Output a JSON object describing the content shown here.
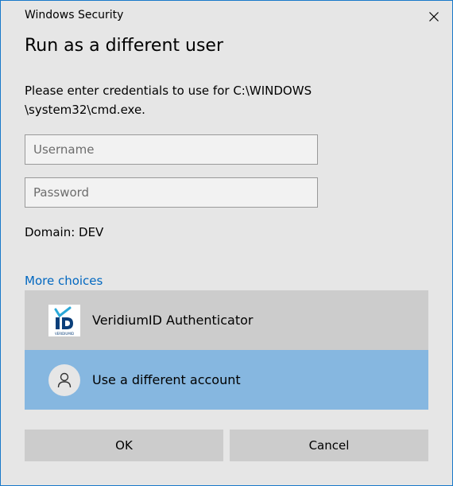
{
  "window": {
    "title": "Windows Security",
    "close_icon": "close-icon",
    "accent_border": "#1979ca"
  },
  "dialog": {
    "heading": "Run as a different user",
    "message_line1": "Please enter credentials to use for C:\\WINDOWS",
    "message_line2": "\\system32\\cmd.exe."
  },
  "form": {
    "username": {
      "value": "",
      "placeholder": "Username"
    },
    "password": {
      "value": "",
      "placeholder": "Password"
    },
    "domain": "Domain: DEV"
  },
  "more_choices": {
    "link": "More choices",
    "link_color": "#0067c0",
    "items": [
      {
        "label": "VeridiumID Authenticator",
        "icon": "veridiumid-logo-icon",
        "logo_text": "VERIDIUMID",
        "selected": false
      },
      {
        "label": "Use a different account",
        "icon": "user-icon",
        "selected": true
      }
    ],
    "selected_color": "#86b7e0"
  },
  "buttons": {
    "ok": "OK",
    "cancel": "Cancel"
  }
}
